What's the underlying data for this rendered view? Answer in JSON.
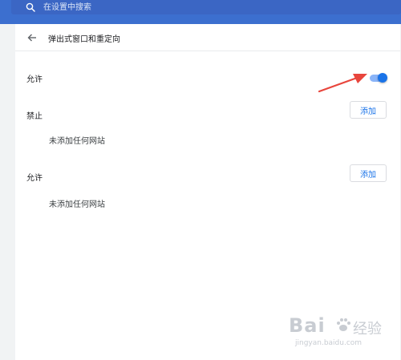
{
  "search": {
    "placeholder": "在设置中搜索"
  },
  "header": {
    "title": "弹出式窗口和重定向"
  },
  "default_setting": {
    "label": "允许",
    "enabled": true
  },
  "block_section": {
    "label": "禁止",
    "add_label": "添加",
    "empty_text": "未添加任何网站"
  },
  "allow_section": {
    "label": "允许",
    "add_label": "添加",
    "empty_text": "未添加任何网站"
  },
  "watermark": {
    "logo": "Bai",
    "name": "经验",
    "url": "jingyan.baidu.com"
  },
  "colors": {
    "topbar": "#3c6fcf",
    "accent": "#1a73e8",
    "toggle_track": "#8ab4f8",
    "annotation_arrow": "#e8453c"
  },
  "icons": [
    "search-icon",
    "back-arrow-icon",
    "annotation-arrow",
    "paw-icon"
  ]
}
